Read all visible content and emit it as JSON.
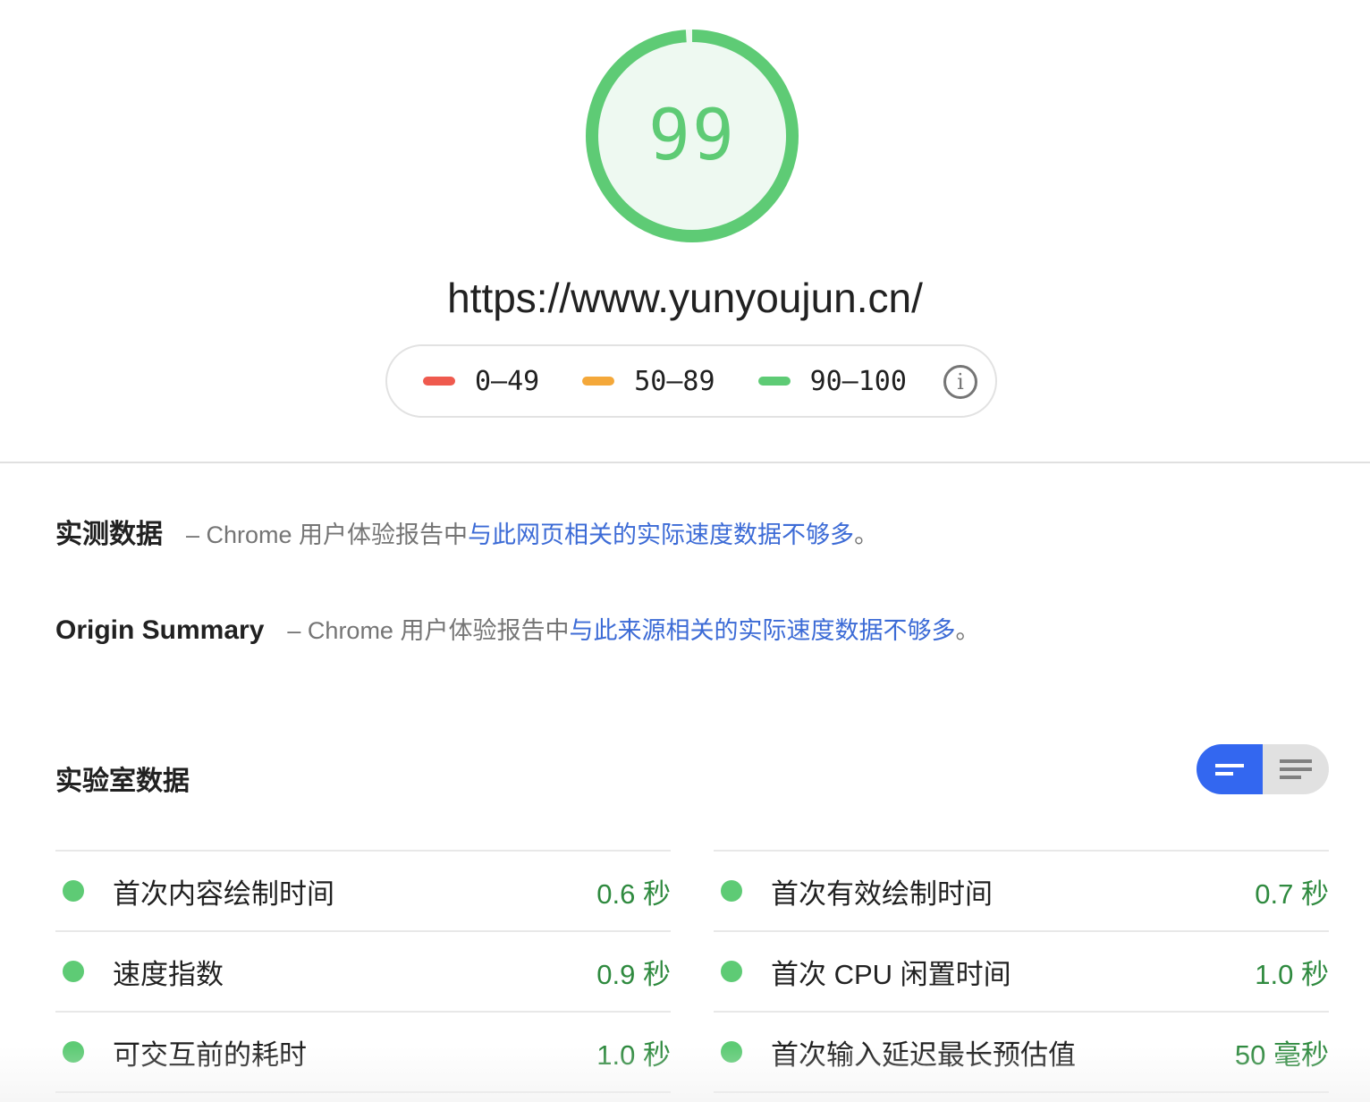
{
  "score": {
    "value": "99",
    "fraction": 0.99,
    "ring_color": "#5ecb75",
    "fill_color": "#eef9f1"
  },
  "url": "https://www.yunyoujun.cn/",
  "legend": {
    "items": [
      {
        "label": "0–49",
        "color": "#ef5a4e"
      },
      {
        "label": "50–89",
        "color": "#f4a83a"
      },
      {
        "label": "90–100",
        "color": "#5ecb75"
      }
    ],
    "info_icon": "info-icon",
    "info_glyph": "i"
  },
  "field_data": {
    "title": "实测数据",
    "desc": "– Chrome 用户体验报告中",
    "link": "与此网页相关的实际速度数据不够多",
    "end": "。"
  },
  "origin_summary": {
    "title": "Origin Summary",
    "desc": "– Chrome 用户体验报告中",
    "link": "与此来源相关的实际速度数据不够多",
    "end": "。"
  },
  "lab_data": {
    "title": "实验室数据",
    "toggle": {
      "active_icon": "compact-view-icon",
      "inactive_icon": "expanded-view-icon",
      "active_color": "#3367f0"
    },
    "metrics": [
      {
        "name": "首次内容绘制时间",
        "value": "0.6 秒",
        "status": "pass"
      },
      {
        "name": "首次有效绘制时间",
        "value": "0.7 秒",
        "status": "pass"
      },
      {
        "name": "速度指数",
        "value": "0.9 秒",
        "status": "pass"
      },
      {
        "name": "首次 CPU 闲置时间",
        "value": "1.0 秒",
        "status": "pass"
      },
      {
        "name": "可交互前的耗时",
        "value": "1.0 秒",
        "status": "pass"
      },
      {
        "name": "首次输入延迟最长预估值",
        "value": "50 毫秒",
        "status": "pass"
      }
    ]
  }
}
